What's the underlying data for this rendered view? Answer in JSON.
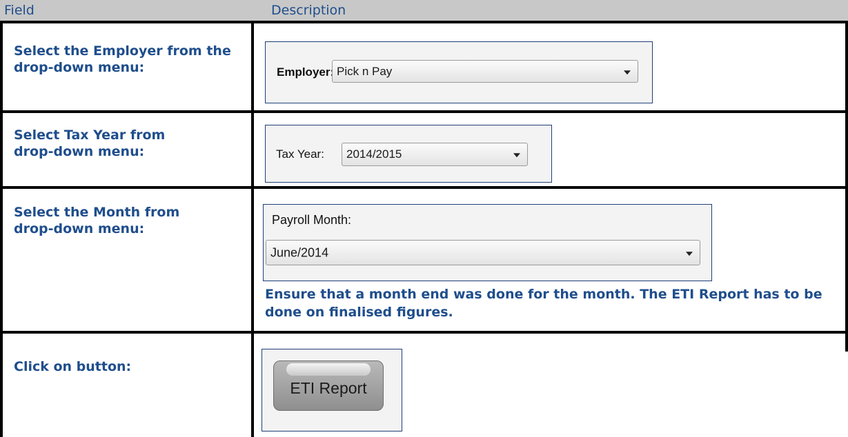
{
  "header": {
    "field_label": "Field",
    "description_label": "Description"
  },
  "rows": [
    {
      "field": "Select the Employer from the drop-down menu:"
    },
    {
      "field": "Select Tax Year from drop-down menu:"
    },
    {
      "field": "Select the Month from drop-down menu:"
    },
    {
      "field": "Click on button:"
    }
  ],
  "employer": {
    "label": "Employer:",
    "value": "Pick n Pay"
  },
  "tax_year": {
    "label": "Tax Year:",
    "value": "2014/2015"
  },
  "payroll_month": {
    "label": "Payroll Month:",
    "value": "June/2014"
  },
  "month_note": "Ensure that a month end was done for the month. The ETI Report has to be done on finalised figures.",
  "eti_button": {
    "label": "ETI Report"
  }
}
